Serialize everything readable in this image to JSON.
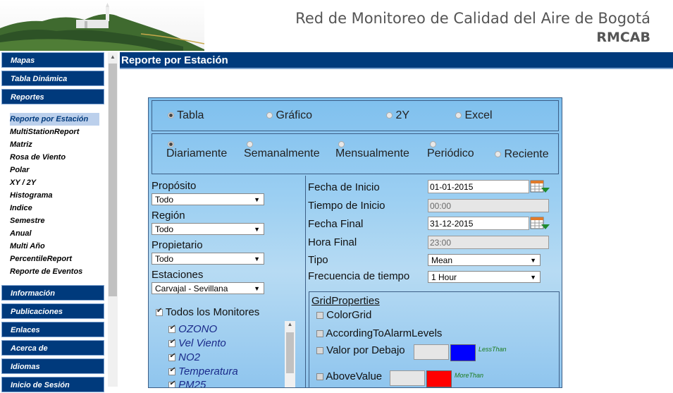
{
  "header": {
    "title": "Red de Monitoreo de Calidad del Aire de Bogotá",
    "subtitle": "RMCAB"
  },
  "sidebar": {
    "top_items": [
      "Mapas",
      "Tabla Dinámica",
      "Reportes"
    ],
    "sub_items": [
      "Reporte por Estación",
      "MultiStationReport",
      "Matriz",
      "Rosa de Viento",
      "Polar",
      "XY / 2Y",
      "Histograma",
      "Indice",
      "Semestre",
      "Anual",
      "Multi Año",
      "PercentileReport",
      "Reporte de Eventos"
    ],
    "bottom_items": [
      "Información",
      "Publicaciones",
      "Enlaces",
      "Acerca de",
      "Idiomas",
      "Inicio de Sesión"
    ]
  },
  "page": {
    "title": "Reporte por Estación"
  },
  "output_types": [
    "Tabla",
    "Gráfico",
    "2Y",
    "Excel"
  ],
  "periods": [
    "Diariamente",
    "Semanalmente",
    "Mensualmente",
    "Periódico",
    "Reciente"
  ],
  "left_form": {
    "proposito_label": "Propósito",
    "proposito_value": "Todo",
    "region_label": "Región",
    "region_value": "Todo",
    "propietario_label": "Propietario",
    "propietario_value": "Todo",
    "estaciones_label": "Estaciones",
    "estaciones_value": "Carvajal - Sevillana",
    "all_monitors_label": "Todos los Monitores",
    "monitors": [
      "OZONO",
      "Vel Viento",
      "NO2",
      "Temperatura",
      "PM25"
    ]
  },
  "right_form": {
    "fecha_inicio_label": "Fecha de Inicio",
    "fecha_inicio_value": "01-01-2015",
    "tiempo_inicio_label": "Tiempo de Inicio",
    "tiempo_inicio_value": "00:00",
    "fecha_final_label": "Fecha Final",
    "fecha_final_value": "31-12-2015",
    "hora_final_label": "Hora Final",
    "hora_final_value": "23:00",
    "tipo_label": "Tipo",
    "tipo_value": "Mean",
    "frecuencia_label": "Frecuencia de tiempo",
    "frecuencia_value": "1 Hour"
  },
  "grid": {
    "title": "GridProperties",
    "color_grid": "ColorGrid",
    "alarm_levels": "AccordingToAlarmLevels",
    "below_label": "Valor por Debajo",
    "below_tag": "LessThan",
    "below_color": "#0000ff",
    "above_label": "AboveValue",
    "above_tag": "MoreThan",
    "above_color": "#ff0000"
  }
}
